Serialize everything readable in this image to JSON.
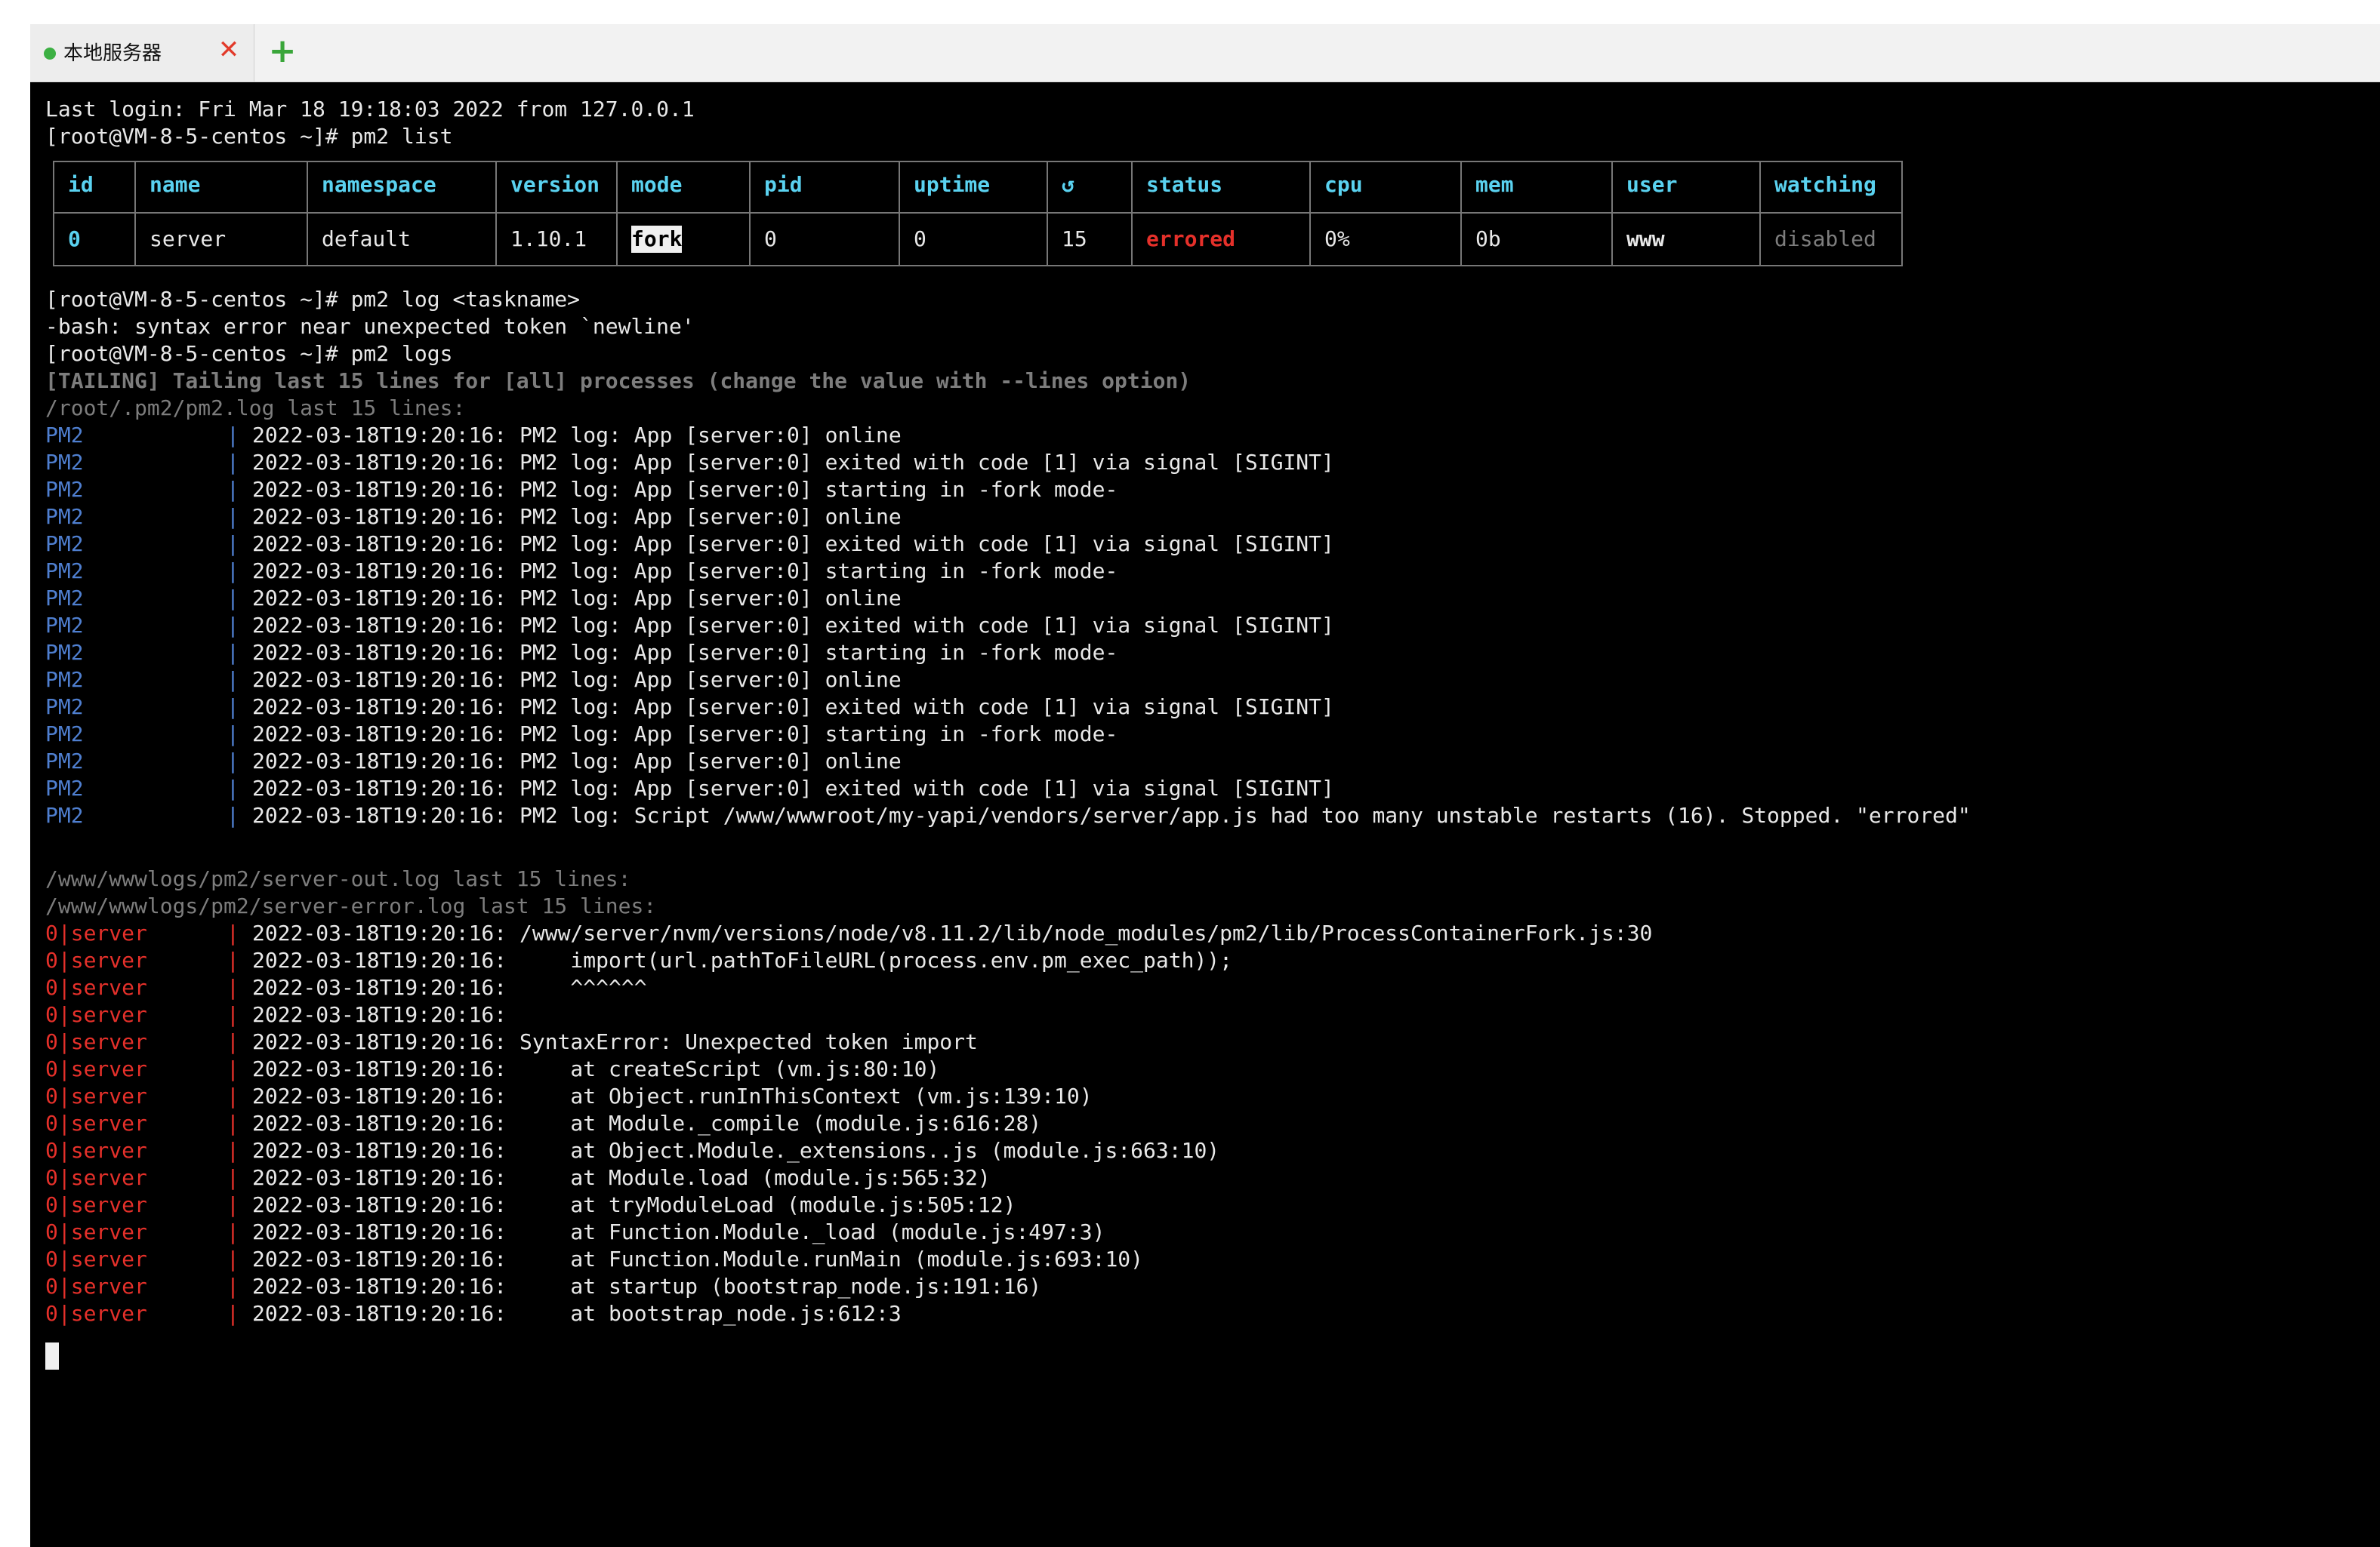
{
  "tabs": {
    "active_label": "本地服务器",
    "close_symbol": "✕",
    "add_symbol": "+"
  },
  "terminal": {
    "header_lines": [
      "Last login: Fri Mar 18 19:18:03 2022 from 127.0.0.1",
      "[root@VM-8-5-centos ~]# pm2 list"
    ],
    "table": {
      "headers": [
        "id",
        "name",
        "namespace",
        "version",
        "mode",
        "pid",
        "uptime",
        "↺",
        "status",
        "cpu",
        "mem",
        "user",
        "watching"
      ],
      "row": [
        "0",
        "server",
        "default",
        "1.10.1",
        "fork",
        "0",
        "0",
        "15",
        "errored",
        "0%",
        "0b",
        "www",
        "disabled"
      ]
    },
    "after_table_lines": [
      "[root@VM-8-5-centos ~]# pm2 log <taskname>",
      "-bash: syntax error near unexpected token `newline'",
      "[root@VM-8-5-centos ~]# pm2 logs"
    ],
    "tailing_line": "[TAILING] Tailing last 15 lines for [all] processes (change the value with --lines option)",
    "pm2_log_header": "/root/.pm2/pm2.log last 15 lines:",
    "pm2_prefix": "PM2",
    "pm2_logs": [
      "2022-03-18T19:20:16: PM2 log: App [server:0] online",
      "2022-03-18T19:20:16: PM2 log: App [server:0] exited with code [1] via signal [SIGINT]",
      "2022-03-18T19:20:16: PM2 log: App [server:0] starting in -fork mode-",
      "2022-03-18T19:20:16: PM2 log: App [server:0] online",
      "2022-03-18T19:20:16: PM2 log: App [server:0] exited with code [1] via signal [SIGINT]",
      "2022-03-18T19:20:16: PM2 log: App [server:0] starting in -fork mode-",
      "2022-03-18T19:20:16: PM2 log: App [server:0] online",
      "2022-03-18T19:20:16: PM2 log: App [server:0] exited with code [1] via signal [SIGINT]",
      "2022-03-18T19:20:16: PM2 log: App [server:0] starting in -fork mode-",
      "2022-03-18T19:20:16: PM2 log: App [server:0] online",
      "2022-03-18T19:20:16: PM2 log: App [server:0] exited with code [1] via signal [SIGINT]",
      "2022-03-18T19:20:16: PM2 log: App [server:0] starting in -fork mode-",
      "2022-03-18T19:20:16: PM2 log: App [server:0] online",
      "2022-03-18T19:20:16: PM2 log: App [server:0] exited with code [1] via signal [SIGINT]",
      "2022-03-18T19:20:16: PM2 log: Script /www/wwwroot/my-yapi/vendors/server/app.js had too many unstable restarts (16). Stopped. \"errored\""
    ],
    "out_log_header": "/www/wwwlogs/pm2/server-out.log last 15 lines:",
    "err_log_header": "/www/wwwlogs/pm2/server-error.log last 15 lines:",
    "server_prefix": "0|server",
    "server_errors": [
      "2022-03-18T19:20:16: /www/server/nvm/versions/node/v8.11.2/lib/node_modules/pm2/lib/ProcessContainerFork.js:30",
      "2022-03-18T19:20:16:     import(url.pathToFileURL(process.env.pm_exec_path));",
      "2022-03-18T19:20:16:     ^^^^^^",
      "2022-03-18T19:20:16:",
      "2022-03-18T19:20:16: SyntaxError: Unexpected token import",
      "2022-03-18T19:20:16:     at createScript (vm.js:80:10)",
      "2022-03-18T19:20:16:     at Object.runInThisContext (vm.js:139:10)",
      "2022-03-18T19:20:16:     at Module._compile (module.js:616:28)",
      "2022-03-18T19:20:16:     at Object.Module._extensions..js (module.js:663:10)",
      "2022-03-18T19:20:16:     at Module.load (module.js:565:32)",
      "2022-03-18T19:20:16:     at tryModuleLoad (module.js:505:12)",
      "2022-03-18T19:20:16:     at Function.Module._load (module.js:497:3)",
      "2022-03-18T19:20:16:     at Function.Module.runMain (module.js:693:10)",
      "2022-03-18T19:20:16:     at startup (bootstrap_node.js:191:16)",
      "2022-03-18T19:20:16:     at bootstrap_node.js:612:3"
    ],
    "colors": {
      "background": "#000000",
      "text": "#e8e8e8",
      "pm2_prefix": "#4f7fd0",
      "error_prefix": "#e5302a",
      "table_header": "#5ad2f0",
      "status_errored": "#e5302a",
      "dim": "#7d7d7d"
    }
  }
}
